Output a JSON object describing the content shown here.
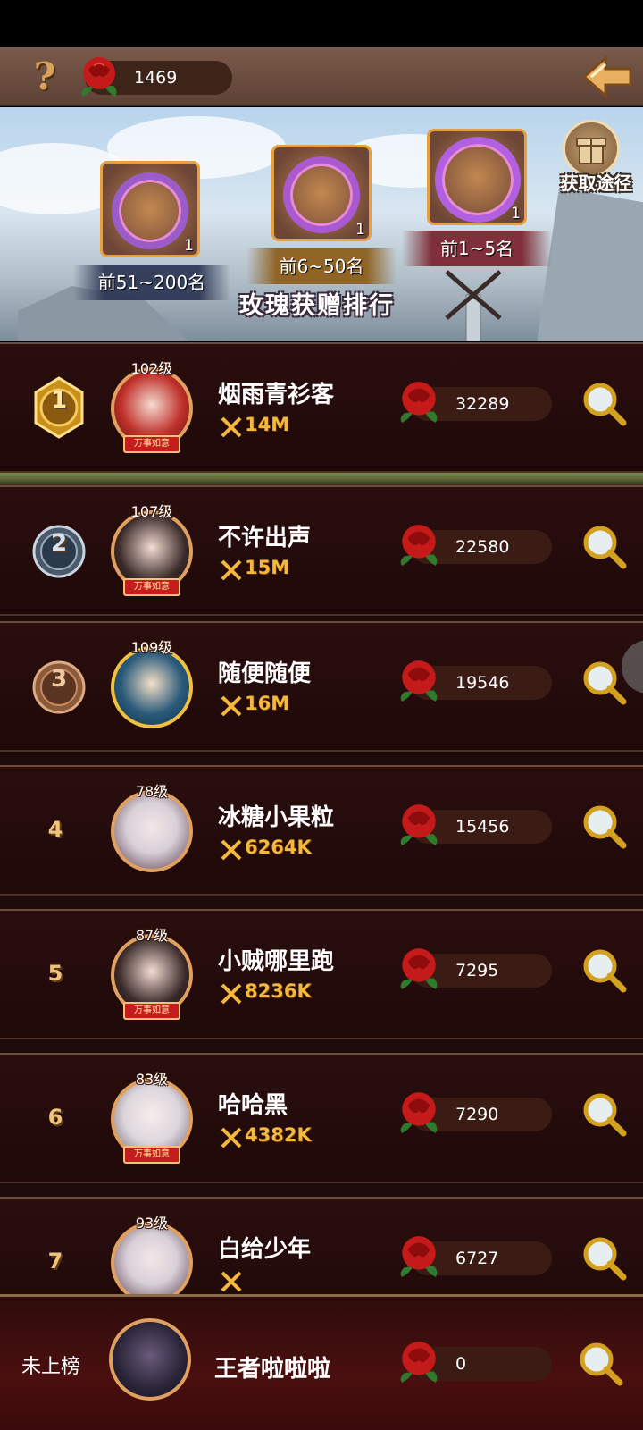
{
  "header": {
    "help_icon": "?",
    "rose_count": "1469"
  },
  "banner": {
    "title": "玫瑰获赠排行",
    "gift_label": "获取途径",
    "rewards": [
      {
        "rank_label": "前51~200名",
        "count": "1"
      },
      {
        "rank_label": "前6~50名",
        "count": "1"
      },
      {
        "rank_label": "前1~5名",
        "count": "1"
      }
    ]
  },
  "ranking": [
    {
      "rank": "1",
      "level": "102级",
      "name": "烟雨青衫客",
      "power": "14M",
      "roses": "32289",
      "tag": "万事如意"
    },
    {
      "rank": "2",
      "level": "107级",
      "name": "不许出声",
      "power": "15M",
      "roses": "22580",
      "tag": "万事如意"
    },
    {
      "rank": "3",
      "level": "109级",
      "name": "随便随便",
      "power": "16M",
      "roses": "19546",
      "tag": ""
    },
    {
      "rank": "4",
      "level": "78级",
      "name": "冰糖小果粒",
      "power": "6264K",
      "roses": "15456",
      "tag": ""
    },
    {
      "rank": "5",
      "level": "87级",
      "name": "小贼哪里跑",
      "power": "8236K",
      "roses": "7295",
      "tag": "万事如意"
    },
    {
      "rank": "6",
      "level": "83级",
      "name": "哈哈黑",
      "power": "4382K",
      "roses": "7290",
      "tag": "万事如意"
    },
    {
      "rank": "7",
      "level": "93级",
      "name": "白给少年",
      "power": "",
      "roses": "6727",
      "tag": ""
    }
  ],
  "me": {
    "rank_text": "未上榜",
    "name": "王者啦啦啦",
    "roses": "0"
  },
  "colors": {
    "accent_gold": "#f4b83a",
    "row_bg": "#2a0e0e",
    "topbar": "#7a5a4a"
  }
}
